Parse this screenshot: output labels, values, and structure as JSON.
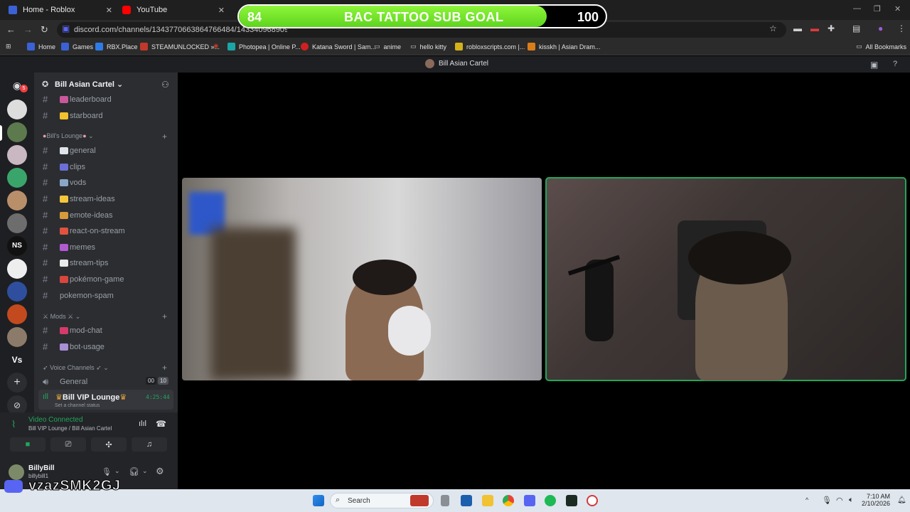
{
  "browser": {
    "tabs": [
      {
        "title": "Home - Roblox",
        "color": "#3a62d6"
      },
      {
        "title": "YouTube",
        "color": "#ff0000"
      }
    ],
    "url": "discord.com/channels/1343770663864766484/1433409689093279877",
    "bookmarks": [
      {
        "label": "Home",
        "color": "#3a62d6"
      },
      {
        "label": "Games",
        "color": "#3a62d6"
      },
      {
        "label": "RBX.Place",
        "color": "#2f7be5"
      },
      {
        "label": "STEAMUNLOCKED »...",
        "color": "#c0392b"
      },
      {
        "label": "Photopea | Online P...",
        "color": "#1aa6a6"
      },
      {
        "label": "Katana Sword | Sam...",
        "color": "#d12020"
      },
      {
        "label": "anime",
        "color": "#999999"
      },
      {
        "label": "hello kitty",
        "color": "#999999"
      },
      {
        "label": "robloxscripts.com |...",
        "color": "#d4b21a"
      },
      {
        "label": "kisskh | Asian Dram...",
        "color": "#d87d1a"
      }
    ],
    "all_bookmarks": "All Bookmarks"
  },
  "goal": {
    "current": "84",
    "title": "BAC TATTOO SUB GOAL",
    "target": "100",
    "progress": 0.84
  },
  "discord": {
    "window_title": "Bill Asian Cartel",
    "server_name": "Bill Asian Cartel",
    "channels_top": [
      {
        "name": "leaderboard",
        "emoji_color": "#c8589b"
      },
      {
        "name": "starboard",
        "emoji_color": "#f2c12e"
      }
    ],
    "category_lounge": "Bill's Lounge",
    "lounge_channels": [
      {
        "name": "general",
        "emoji_color": "#dfe3ea"
      },
      {
        "name": "clips",
        "emoji_color": "#6b6fd6"
      },
      {
        "name": "vods",
        "emoji_color": "#8aa6c7"
      },
      {
        "name": "stream-ideas",
        "emoji_color": "#f3c63b"
      },
      {
        "name": "emote-ideas",
        "emoji_color": "#d79a3a"
      },
      {
        "name": "react-on-stream",
        "emoji_color": "#e0533f"
      },
      {
        "name": "memes",
        "emoji_color": "#b25bd1"
      },
      {
        "name": "stream-tips",
        "emoji_color": "#e9e9e9"
      },
      {
        "name": "pokémon-game",
        "emoji_color": "#d9463e"
      },
      {
        "name": "pokemon-spam",
        "emoji_color": ""
      }
    ],
    "category_mods": "Mods",
    "mod_channels": [
      {
        "name": "mod-chat",
        "emoji_color": "#d23b6a"
      },
      {
        "name": "bot-usage",
        "emoji_color": "#a98ed8"
      }
    ],
    "category_voice": "Voice Channels",
    "voice_general": {
      "name": "General",
      "count_a": "00",
      "count_b": "10"
    },
    "voice_vip": {
      "name": "Bill VIP Lounge",
      "timer": "4:25:44",
      "status": "Set a channel status"
    },
    "connection": {
      "status": "Video Connected",
      "location": "Bill VIP Lounge / Bill Asian Cartel"
    },
    "user": {
      "display": "BillyBill",
      "tag": "billybill1"
    },
    "mention_badge": "5"
  },
  "overlay_code": "vzazSMK2GJ",
  "taskbar": {
    "search": "Search",
    "time": "7:10 AM",
    "date": "2/10/2026"
  }
}
